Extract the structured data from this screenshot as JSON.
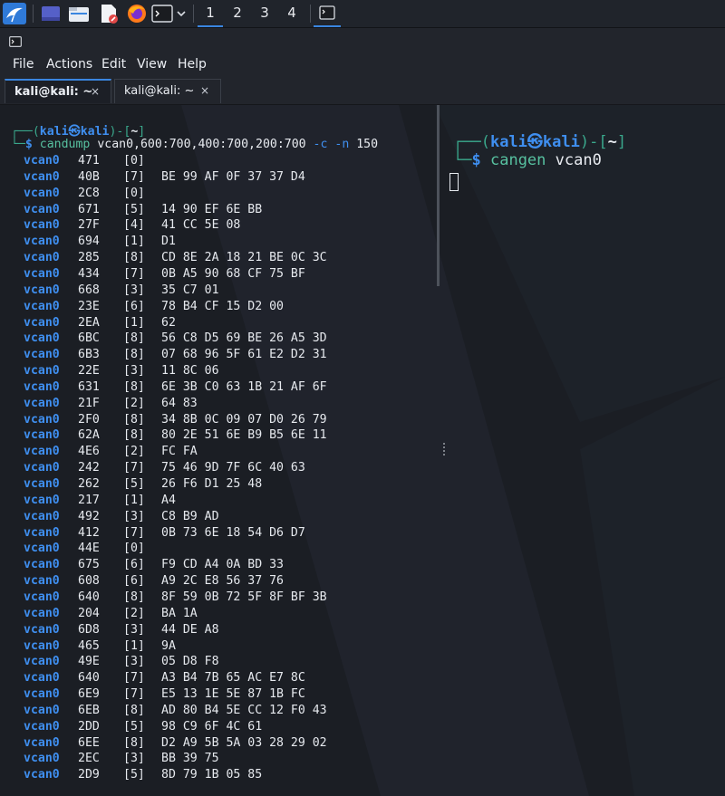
{
  "taskbar": {
    "workspaces": [
      "1",
      "2",
      "3",
      "4"
    ],
    "active_workspace": "1",
    "icons": [
      "kali-menu-icon",
      "desktop-icon",
      "file-manager-icon",
      "text-editor-icon",
      "firefox-icon",
      "terminal-icon",
      "chevron-down-icon",
      "terminal-window-icon"
    ]
  },
  "menubar": {
    "items": [
      "File",
      "Actions",
      "Edit",
      "View",
      "Help"
    ]
  },
  "tabs": [
    {
      "label": "kali@kali: ~",
      "close": "×",
      "active": true
    },
    {
      "label": "kali@kali: ~",
      "close": "×",
      "active": false
    }
  ],
  "left_pane": {
    "prompt": {
      "open": "┌──(",
      "user": "kali",
      "at": "㉿",
      "host": "kali",
      "mid": ")-[",
      "dir": "~",
      "close": "]",
      "line2": "└─",
      "dollar": "$",
      "cmd": "candump",
      "args": "vcan0,600:700,400:700,200:700",
      "flag1": "-c",
      "flag2": "-n",
      "num": "150"
    },
    "rows": [
      {
        "iface": "vcan0",
        "id": "471",
        "dlc": "[0]",
        "data": ""
      },
      {
        "iface": "vcan0",
        "id": "40B",
        "dlc": "[7]",
        "data": "BE 99 AF 0F 37 37 D4"
      },
      {
        "iface": "vcan0",
        "id": "2C8",
        "dlc": "[0]",
        "data": ""
      },
      {
        "iface": "vcan0",
        "id": "671",
        "dlc": "[5]",
        "data": "14 90 EF 6E BB"
      },
      {
        "iface": "vcan0",
        "id": "27F",
        "dlc": "[4]",
        "data": "41 CC 5E 08"
      },
      {
        "iface": "vcan0",
        "id": "694",
        "dlc": "[1]",
        "data": "D1"
      },
      {
        "iface": "vcan0",
        "id": "285",
        "dlc": "[8]",
        "data": "CD 8E 2A 18 21 BE 0C 3C"
      },
      {
        "iface": "vcan0",
        "id": "434",
        "dlc": "[7]",
        "data": "0B A5 90 68 CF 75 BF"
      },
      {
        "iface": "vcan0",
        "id": "668",
        "dlc": "[3]",
        "data": "35 C7 01"
      },
      {
        "iface": "vcan0",
        "id": "23E",
        "dlc": "[6]",
        "data": "78 B4 CF 15 D2 00"
      },
      {
        "iface": "vcan0",
        "id": "2EA",
        "dlc": "[1]",
        "data": "62"
      },
      {
        "iface": "vcan0",
        "id": "6BC",
        "dlc": "[8]",
        "data": "56 C8 D5 69 BE 26 A5 3D"
      },
      {
        "iface": "vcan0",
        "id": "6B3",
        "dlc": "[8]",
        "data": "07 68 96 5F 61 E2 D2 31"
      },
      {
        "iface": "vcan0",
        "id": "22E",
        "dlc": "[3]",
        "data": "11 8C 06"
      },
      {
        "iface": "vcan0",
        "id": "631",
        "dlc": "[8]",
        "data": "6E 3B C0 63 1B 21 AF 6F"
      },
      {
        "iface": "vcan0",
        "id": "21F",
        "dlc": "[2]",
        "data": "64 83"
      },
      {
        "iface": "vcan0",
        "id": "2F0",
        "dlc": "[8]",
        "data": "34 8B 0C 09 07 D0 26 79"
      },
      {
        "iface": "vcan0",
        "id": "62A",
        "dlc": "[8]",
        "data": "80 2E 51 6E B9 B5 6E 11"
      },
      {
        "iface": "vcan0",
        "id": "4E6",
        "dlc": "[2]",
        "data": "FC FA"
      },
      {
        "iface": "vcan0",
        "id": "242",
        "dlc": "[7]",
        "data": "75 46 9D 7F 6C 40 63"
      },
      {
        "iface": "vcan0",
        "id": "262",
        "dlc": "[5]",
        "data": "26 F6 D1 25 48"
      },
      {
        "iface": "vcan0",
        "id": "217",
        "dlc": "[1]",
        "data": "A4"
      },
      {
        "iface": "vcan0",
        "id": "492",
        "dlc": "[3]",
        "data": "C8 B9 AD"
      },
      {
        "iface": "vcan0",
        "id": "412",
        "dlc": "[7]",
        "data": "0B 73 6E 18 54 D6 D7"
      },
      {
        "iface": "vcan0",
        "id": "44E",
        "dlc": "[0]",
        "data": ""
      },
      {
        "iface": "vcan0",
        "id": "675",
        "dlc": "[6]",
        "data": "F9 CD A4 0A BD 33"
      },
      {
        "iface": "vcan0",
        "id": "608",
        "dlc": "[6]",
        "data": "A9 2C E8 56 37 76"
      },
      {
        "iface": "vcan0",
        "id": "640",
        "dlc": "[8]",
        "data": "8F 59 0B 72 5F 8F BF 3B"
      },
      {
        "iface": "vcan0",
        "id": "204",
        "dlc": "[2]",
        "data": "BA 1A"
      },
      {
        "iface": "vcan0",
        "id": "6D8",
        "dlc": "[3]",
        "data": "44 DE A8"
      },
      {
        "iface": "vcan0",
        "id": "465",
        "dlc": "[1]",
        "data": "9A"
      },
      {
        "iface": "vcan0",
        "id": "49E",
        "dlc": "[3]",
        "data": "05 D8 F8"
      },
      {
        "iface": "vcan0",
        "id": "640",
        "dlc": "[7]",
        "data": "A3 B4 7B 65 AC E7 8C"
      },
      {
        "iface": "vcan0",
        "id": "6E9",
        "dlc": "[7]",
        "data": "E5 13 1E 5E 87 1B FC"
      },
      {
        "iface": "vcan0",
        "id": "6EB",
        "dlc": "[8]",
        "data": "AD 80 B4 5E CC 12 F0 43"
      },
      {
        "iface": "vcan0",
        "id": "2DD",
        "dlc": "[5]",
        "data": "98 C9 6F 4C 61"
      },
      {
        "iface": "vcan0",
        "id": "6EE",
        "dlc": "[8]",
        "data": "D2 A9 5B 5A 03 28 29 02"
      },
      {
        "iface": "vcan0",
        "id": "2EC",
        "dlc": "[3]",
        "data": "BB 39 75"
      },
      {
        "iface": "vcan0",
        "id": "2D9",
        "dlc": "[5]",
        "data": "8D 79 1B 05 85"
      }
    ]
  },
  "right_pane": {
    "prompt": {
      "open": "┌──(",
      "user": "kali",
      "at": "㉿",
      "host": "kali",
      "mid": ")-[",
      "dir": "~",
      "close": "]",
      "line2": "└─",
      "dollar": "$",
      "cmd": "cangen",
      "args": "vcan0"
    }
  },
  "colors": {
    "accent": "#3a86e0",
    "prompt_blue": "#3f8ff0",
    "prompt_green": "#57c1a0",
    "flag_red": "#e05a6b"
  }
}
